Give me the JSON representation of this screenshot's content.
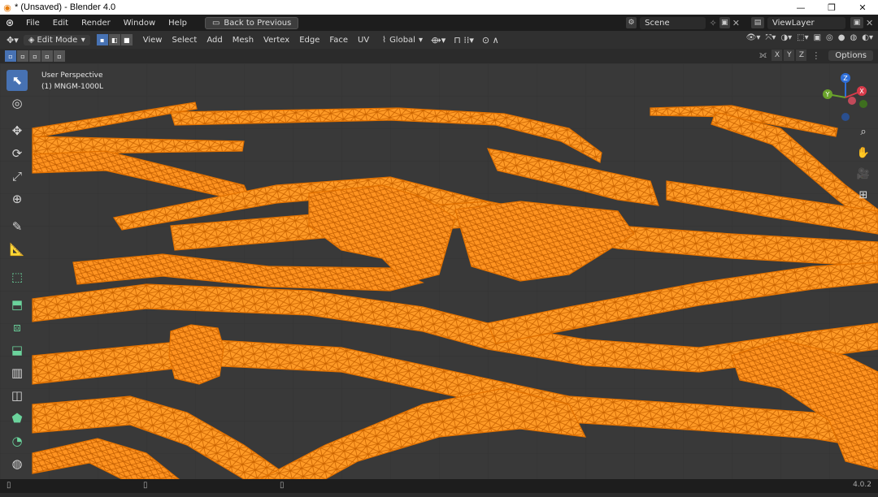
{
  "window": {
    "title": "* (Unsaved) - Blender 4.0",
    "controls": [
      "—",
      "❐",
      "✕"
    ]
  },
  "topbar": {
    "menu": [
      "File",
      "Edit",
      "Render",
      "Window",
      "Help"
    ],
    "back_button": "Back to Previous",
    "scene": "Scene",
    "view_layer": "ViewLayer"
  },
  "header": {
    "mode": "Edit Mode",
    "select_modes": [
      "vertex",
      "edge",
      "face"
    ],
    "active_select_mode": "vertex",
    "menus": [
      "View",
      "Select",
      "Add",
      "Mesh",
      "Vertex",
      "Edge",
      "Face",
      "UV"
    ],
    "orientation": "Global"
  },
  "row2": {
    "axes": [
      "X",
      "Y",
      "Z"
    ],
    "options_label": "Options"
  },
  "viewport": {
    "perspective": "User Perspective",
    "object": "(1) MNGM-1000L",
    "gizmo": {
      "z": "Z",
      "y": "Y",
      "x": "X"
    }
  },
  "tools": [
    {
      "name": "select-box-tool",
      "icon": "cursor-arrow-icon",
      "glyph": "⬉",
      "active": true
    },
    {
      "name": "cursor-tool",
      "icon": "cursor-target-icon",
      "glyph": "◎"
    },
    {
      "name": "move-tool",
      "icon": "move-icon",
      "glyph": "✥"
    },
    {
      "name": "rotate-tool",
      "icon": "rotate-icon",
      "glyph": "⟳"
    },
    {
      "name": "scale-tool",
      "icon": "scale-icon",
      "glyph": "⤢"
    },
    {
      "name": "transform-tool",
      "icon": "transform-icon",
      "glyph": "⊕"
    },
    {
      "name": "annotate-tool",
      "icon": "annotate-icon",
      "glyph": "✎"
    },
    {
      "name": "measure-tool",
      "icon": "measure-icon",
      "glyph": "📐"
    },
    {
      "name": "add-cube-tool",
      "icon": "add-cube-icon",
      "glyph": "⬚"
    },
    {
      "name": "extrude-tool",
      "icon": "extrude-icon",
      "glyph": "⬒"
    },
    {
      "name": "inset-tool",
      "icon": "inset-icon",
      "glyph": "⧈"
    },
    {
      "name": "bevel-tool",
      "icon": "bevel-icon",
      "glyph": "⬓"
    },
    {
      "name": "loop-cut-tool",
      "icon": "loop-cut-icon",
      "glyph": "▥"
    },
    {
      "name": "knife-tool",
      "icon": "knife-icon",
      "glyph": "◫"
    },
    {
      "name": "poly-build-tool",
      "icon": "poly-build-icon",
      "glyph": "⬟"
    },
    {
      "name": "spin-tool",
      "icon": "spin-icon",
      "glyph": "◔"
    },
    {
      "name": "smooth-tool",
      "icon": "smooth-icon",
      "glyph": "◍"
    },
    {
      "name": "shear-tool",
      "icon": "shear-icon",
      "glyph": "▱"
    }
  ],
  "status": {
    "version": "4.0.2"
  },
  "colors": {
    "accent": "#4772b3",
    "mesh": "#ff8c10",
    "wire": "#e07000"
  }
}
